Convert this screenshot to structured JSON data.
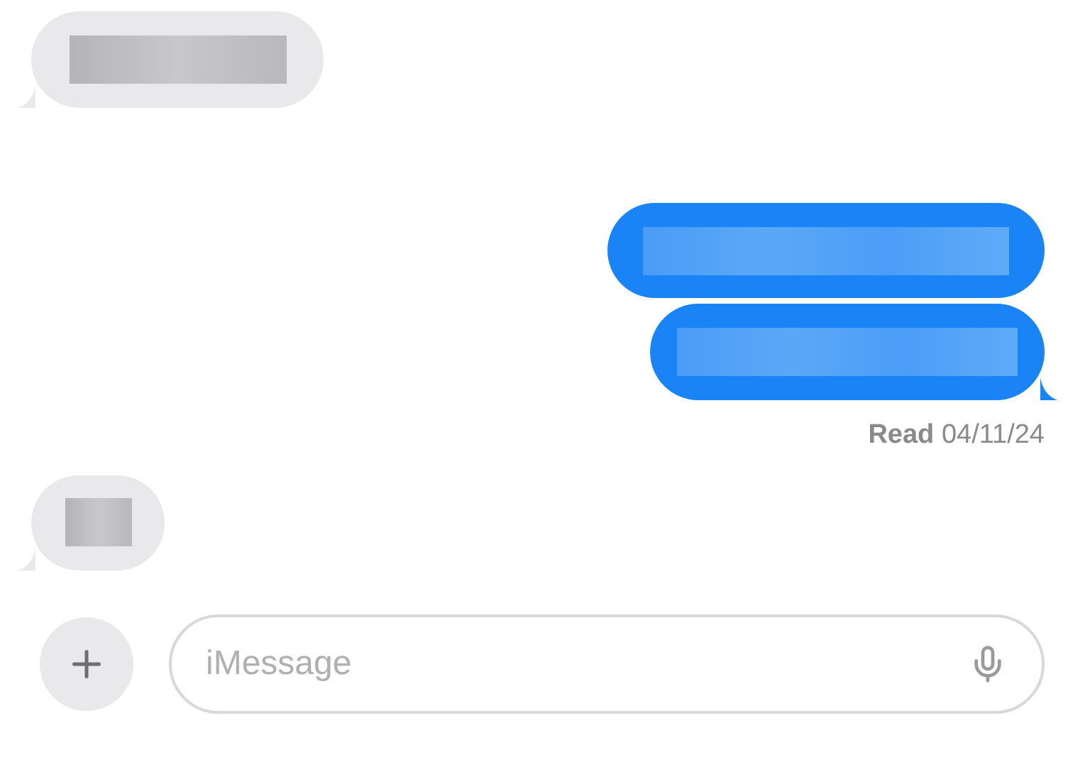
{
  "messages": [
    {
      "kind": "incoming",
      "redacted": true
    },
    {
      "kind": "outgoing",
      "redacted": true
    },
    {
      "kind": "outgoing",
      "redacted": true
    }
  ],
  "receipt": "**Read** 04/11/24",
  "messages_after": [
    {
      "kind": "incoming",
      "redacted": true
    }
  ],
  "composer": {
    "placeholder": "iMessage"
  }
}
